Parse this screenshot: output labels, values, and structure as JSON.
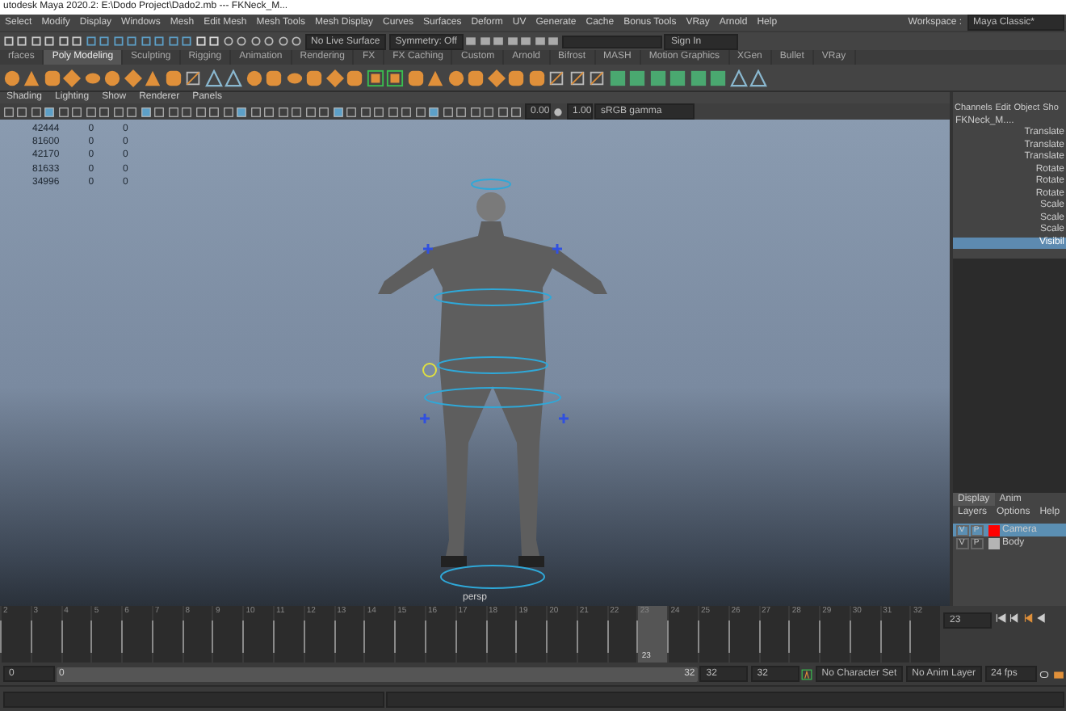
{
  "window": {
    "title": "utodesk Maya 2020.2: E:\\Dodo Project\\Dado2.mb  ---  FKNeck_M..."
  },
  "menu_bar": {
    "items": [
      "Select",
      "Modify",
      "Display",
      "Windows",
      "Mesh",
      "Edit Mesh",
      "Mesh Tools",
      "Mesh Display",
      "Curves",
      "Surfaces",
      "Deform",
      "UV",
      "Generate",
      "Cache",
      "Bonus Tools",
      "VRay",
      "Arnold",
      "Help"
    ],
    "workspace_label": "Workspace :",
    "workspace_value": "Maya Classic*"
  },
  "status_line": {
    "live_surface": "No Live Surface",
    "symmetry": "Symmetry: Off",
    "sign_in": "Sign In"
  },
  "shelf": {
    "tabs": [
      {
        "label": "rfaces",
        "selected": false
      },
      {
        "label": "Poly Modeling",
        "selected": true
      },
      {
        "label": "Sculpting",
        "selected": false
      },
      {
        "label": "Rigging",
        "selected": false
      },
      {
        "label": "Animation",
        "selected": false
      },
      {
        "label": "Rendering",
        "selected": false
      },
      {
        "label": "FX",
        "selected": false
      },
      {
        "label": "FX Caching",
        "selected": false
      },
      {
        "label": "Custom",
        "selected": false
      },
      {
        "label": "Arnold",
        "selected": false
      },
      {
        "label": "Bifrost",
        "selected": false
      },
      {
        "label": "MASH",
        "selected": false
      },
      {
        "label": "Motion Graphics",
        "selected": false
      },
      {
        "label": "XGen",
        "selected": false
      },
      {
        "label": "Bullet",
        "selected": false
      },
      {
        "label": "VRay",
        "selected": false
      }
    ]
  },
  "viewport": {
    "menus": [
      "Shading",
      "Lighting",
      "Show",
      "Renderer",
      "Panels"
    ],
    "exposure": "0.00",
    "gamma": "1.00",
    "color_space": "sRGB gamma",
    "hud_stats": [
      {
        "values": [
          "42444",
          "0",
          "0"
        ]
      },
      {
        "values": [
          "81600",
          "0",
          "0"
        ]
      },
      {
        "values": [
          "42170",
          "0",
          "0"
        ]
      },
      {
        "values": [
          "81633",
          "0",
          "0"
        ]
      },
      {
        "values": [
          "34996",
          "0",
          "0"
        ]
      }
    ],
    "camera_label": "persp"
  },
  "channel_box": {
    "tabs": [
      "Channels",
      "Edit",
      "Object",
      "Sho"
    ],
    "object_name": "FKNeck_M....",
    "attributes": [
      {
        "label": "Translate",
        "selected": false
      },
      {
        "label": "Translate",
        "selected": false
      },
      {
        "label": "Translate",
        "selected": false
      },
      {
        "label": "Rotate",
        "selected": false
      },
      {
        "label": "Rotate",
        "selected": false
      },
      {
        "label": "Rotate",
        "selected": false
      },
      {
        "label": "Scale",
        "selected": false
      },
      {
        "label": "Scale",
        "selected": false
      },
      {
        "label": "Scale",
        "selected": false
      },
      {
        "label": "Visibil",
        "selected": true
      }
    ]
  },
  "layer_editor": {
    "tabs": [
      {
        "label": "Display",
        "selected": true
      },
      {
        "label": "Anim",
        "selected": false
      }
    ],
    "menus": [
      "Layers",
      "Options",
      "Help"
    ],
    "layers": [
      {
        "name": "Camera",
        "visible_label": "V",
        "playback_label": "P",
        "color": "#ff0000",
        "selected": true
      },
      {
        "name": "Body",
        "visible_label": "V",
        "playback_label": "P",
        "color": "#b4b4b4",
        "selected": false
      }
    ]
  },
  "time_slider": {
    "ticks": [
      {
        "label": "2",
        "selected": false
      },
      {
        "label": "3",
        "selected": false
      },
      {
        "label": "4",
        "selected": false
      },
      {
        "label": "5",
        "selected": false
      },
      {
        "label": "6",
        "selected": false
      },
      {
        "label": "7",
        "selected": false
      },
      {
        "label": "8",
        "selected": false
      },
      {
        "label": "9",
        "selected": false
      },
      {
        "label": "10",
        "selected": false
      },
      {
        "label": "11",
        "selected": false
      },
      {
        "label": "12",
        "selected": false
      },
      {
        "label": "13",
        "selected": false
      },
      {
        "label": "14",
        "selected": false
      },
      {
        "label": "15",
        "selected": false
      },
      {
        "label": "16",
        "selected": false
      },
      {
        "label": "17",
        "selected": false
      },
      {
        "label": "18",
        "selected": false
      },
      {
        "label": "19",
        "selected": false
      },
      {
        "label": "20",
        "selected": false
      },
      {
        "label": "21",
        "selected": false
      },
      {
        "label": "22",
        "selected": false
      },
      {
        "label": "23",
        "selected": true
      },
      {
        "label": "24",
        "selected": false
      },
      {
        "label": "25",
        "selected": false
      },
      {
        "label": "26",
        "selected": false
      },
      {
        "label": "27",
        "selected": false
      },
      {
        "label": "28",
        "selected": false
      },
      {
        "label": "29",
        "selected": false
      },
      {
        "label": "30",
        "selected": false
      },
      {
        "label": "31",
        "selected": false
      },
      {
        "label": "32",
        "selected": false
      }
    ],
    "current_frame_label": "23",
    "current_frame_field": "23"
  },
  "range_slider": {
    "start_field": "0",
    "bar_start": "0",
    "bar_end": "32",
    "end_field": "32",
    "max_field": "32",
    "character_set": "No Character Set",
    "anim_layer": "No Anim Layer",
    "fps": "24 fps"
  }
}
